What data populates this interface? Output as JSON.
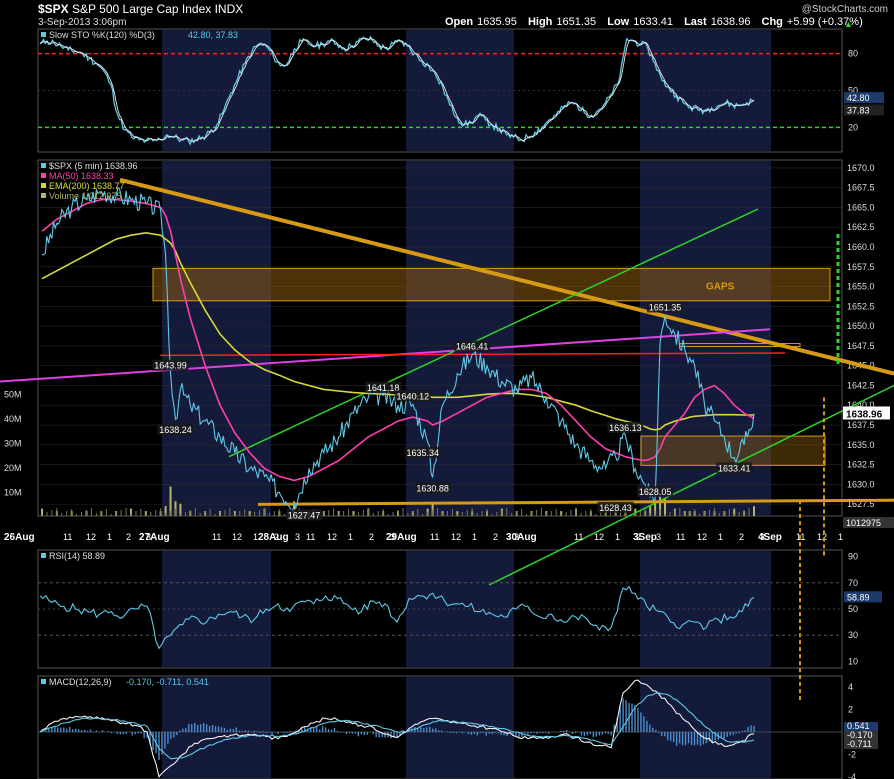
{
  "header": {
    "symbol": "$SPX",
    "name": "S&P 500 Large Cap Index",
    "exchange": "INDX",
    "date": "3-Sep-2013 3:06pm",
    "open_label": "Open",
    "open": "1635.95",
    "high_label": "High",
    "high": "1651.35",
    "low_label": "Low",
    "low": "1633.41",
    "last_label": "Last",
    "last": "1638.96",
    "chg_label": "Chg",
    "chg": "+5.99 (+0.37%)",
    "up_icon": "triangle-up-icon",
    "credit": "@StockCharts.com"
  },
  "colors": {
    "bg": "#000000",
    "band": "#141a3a",
    "price": "#5fc8e6",
    "ma50": "#ff3fb0",
    "ema200": "#d8d83a",
    "trend": "#d79a14",
    "green": "#2bd42b",
    "magenta": "#e040e0",
    "red": "#ff2020",
    "gap_fill": "#8a5a10",
    "volume": "#b6b36a",
    "grid": "#2a2a2a"
  },
  "chart_data": [
    {
      "type": "line",
      "panel": "sto",
      "legend": "Slow STO %K(120) %D(3)",
      "legend_values": "42.80, 37.83",
      "ylim": [
        0,
        100
      ],
      "yticks": [
        "80",
        "50",
        "20"
      ],
      "levels": [
        80,
        20
      ],
      "last_labels": [
        "42.80",
        "37.83"
      ],
      "series": [
        {
          "values": [
            88,
            90,
            89,
            86,
            83,
            82,
            80,
            76,
            72,
            66,
            55,
            30,
            18,
            12,
            10,
            9,
            9,
            10,
            14,
            12,
            10,
            9,
            10,
            12,
            16,
            22,
            34,
            48,
            60,
            72,
            82,
            88,
            86,
            78,
            70,
            72,
            84,
            90,
            88,
            86,
            88,
            90,
            88,
            84,
            86,
            90,
            92,
            91,
            86,
            84,
            88,
            90,
            86,
            80,
            74,
            70,
            62,
            52,
            38,
            28,
            22,
            24,
            30,
            26,
            22,
            18,
            14,
            12,
            10,
            12,
            16,
            20,
            26,
            30,
            36,
            40,
            38,
            32,
            30,
            34,
            40,
            48,
            60,
            92,
            90,
            88,
            84,
            72,
            58,
            52,
            46,
            40,
            36,
            35,
            34,
            36,
            38,
            40,
            38,
            38,
            40,
            42
          ]
        }
      ]
    },
    {
      "type": "line",
      "panel": "price",
      "legends": [
        "$SPX (5 min) 1638.96",
        "MA(50) 1638.33",
        "EMA(200) 1638.77",
        "Volume 1,012,975"
      ],
      "ylim": [
        1626,
        1671
      ],
      "yticks": [
        "1670.0",
        "1667.5",
        "1665.0",
        "1662.5",
        "1660.0",
        "1657.5",
        "1655.0",
        "1652.5",
        "1650.0",
        "1647.5",
        "1645.0",
        "1642.5",
        "1640.0",
        "1637.5",
        "1635.0",
        "1632.5",
        "1630.0",
        "1627.5"
      ],
      "volume_ticks": [
        "50M",
        "40M",
        "30M",
        "20M",
        "10M"
      ],
      "current_price_label": "1638.96",
      "volume_label": "1012975",
      "gap_label": "GAPS",
      "x_labels": [
        "26Aug",
        "11",
        "12",
        "1",
        "2",
        "3",
        "27Aug",
        "11",
        "12",
        "1",
        "2",
        "3",
        "28Aug",
        "11",
        "12",
        "1",
        "2",
        "3",
        "29Aug",
        "11",
        "12",
        "1",
        "2",
        "3",
        "30Aug",
        "11",
        "12",
        "1",
        "2",
        "3",
        "3Sep",
        "11",
        "12",
        "1",
        "2",
        "3",
        "4Sep",
        "11",
        "12",
        "1"
      ],
      "price_labels": [
        {
          "text": "1643.99",
          "x": 26,
          "y": 1643.99
        },
        {
          "text": "1638.24",
          "x": 27,
          "y": 1638.24
        },
        {
          "text": "1627.47",
          "x": 53,
          "y": 1627.47
        },
        {
          "text": "1641.18",
          "x": 69,
          "y": 1641.18
        },
        {
          "text": "1640.12",
          "x": 75,
          "y": 1640.12
        },
        {
          "text": "1635.34",
          "x": 77,
          "y": 1635.34
        },
        {
          "text": "1630.88",
          "x": 79,
          "y": 1630.88
        },
        {
          "text": "1646.41",
          "x": 87,
          "y": 1646.41
        },
        {
          "text": "1636.13",
          "x": 118,
          "y": 1636.13
        },
        {
          "text": "1628.43",
          "x": 116,
          "y": 1628.43
        },
        {
          "text": "1628.05",
          "x": 124,
          "y": 1628.05
        },
        {
          "text": "1651.35",
          "x": 126,
          "y": 1651.35
        },
        {
          "text": "1633.41",
          "x": 140,
          "y": 1633.41
        }
      ],
      "x": [
        0,
        3,
        6,
        9,
        12,
        15,
        18,
        21,
        24,
        25,
        26,
        27,
        28,
        30,
        33,
        36,
        39,
        42,
        45,
        48,
        51,
        54,
        57,
        60,
        63,
        66,
        69,
        72,
        75,
        78,
        79,
        81,
        84,
        87,
        90,
        93,
        96,
        99,
        102,
        105,
        108,
        111,
        114,
        116,
        118,
        120,
        122,
        123,
        124,
        125,
        126,
        128,
        130,
        131,
        132,
        134,
        136,
        138,
        140,
        142,
        144
      ],
      "series": [
        {
          "name": "$SPX",
          "values": [
            1659,
            1663,
            1665,
            1666,
            1667,
            1666.5,
            1666,
            1665.5,
            1664.5,
            1659,
            1643.99,
            1638.24,
            1642,
            1640,
            1638,
            1636,
            1634,
            1632,
            1631,
            1629,
            1627.47,
            1632,
            1634,
            1636,
            1639,
            1641,
            1641.18,
            1640,
            1640.12,
            1635.34,
            1630.88,
            1640,
            1644,
            1646.41,
            1645,
            1643,
            1642,
            1643.5,
            1641,
            1638,
            1635,
            1633,
            1632,
            1633.5,
            1636.13,
            1632,
            1630,
            1628.43,
            1628.05,
            1648,
            1651.35,
            1649,
            1647,
            1646,
            1645,
            1640,
            1638,
            1636,
            1633.41,
            1635,
            1638.96
          ]
        },
        {
          "name": "MA(50)",
          "values": [
            1662,
            1663.5,
            1664.5,
            1665.5,
            1666,
            1666,
            1665.8,
            1665.5,
            1665,
            1664,
            1662,
            1659,
            1656,
            1651,
            1645,
            1640,
            1636.5,
            1634,
            1632,
            1631,
            1630.5,
            1631,
            1632,
            1633,
            1634.5,
            1636,
            1637,
            1638,
            1638.5,
            1638,
            1637.5,
            1638,
            1639,
            1640,
            1641,
            1641.5,
            1642,
            1642,
            1641.5,
            1640,
            1638,
            1636,
            1634.5,
            1634,
            1633.5,
            1633.2,
            1633,
            1633.2,
            1633.5,
            1634.5,
            1636,
            1637.5,
            1639,
            1640,
            1641,
            1642,
            1642.5,
            1641.5,
            1640,
            1639,
            1638.33
          ]
        },
        {
          "name": "EMA(200)",
          "values": [
            1656,
            1657,
            1658,
            1659,
            1660,
            1661,
            1661.5,
            1661.8,
            1661.5,
            1661,
            1660.5,
            1659.5,
            1658,
            1655.5,
            1652,
            1649,
            1647,
            1645.5,
            1644.5,
            1643.8,
            1643,
            1642.5,
            1642,
            1641.8,
            1641.6,
            1641.5,
            1641.4,
            1641.3,
            1641.2,
            1641.1,
            1641,
            1641,
            1641,
            1641.2,
            1641.4,
            1641.5,
            1641.5,
            1641.3,
            1641,
            1640.5,
            1640,
            1639.3,
            1638.7,
            1638.3,
            1638,
            1637.7,
            1637.3,
            1637,
            1636.9,
            1637,
            1637.5,
            1638,
            1638.3,
            1638.5,
            1638.6,
            1638.7,
            1638.8,
            1638.8,
            1638.8,
            1638.77,
            1638.77
          ]
        }
      ],
      "volume": [
        3,
        2,
        2,
        2,
        2,
        2,
        3,
        2,
        2,
        4,
        12,
        6,
        5,
        2,
        2,
        2,
        2,
        2,
        3,
        2,
        6,
        2,
        2,
        2,
        2,
        3,
        2,
        2,
        2,
        3,
        5,
        2,
        2,
        2,
        2,
        3,
        2,
        2,
        2,
        2,
        3,
        2,
        2,
        3,
        2,
        3,
        2,
        4,
        6,
        8,
        7,
        3,
        2,
        2,
        2,
        2,
        2,
        2,
        3,
        2,
        4
      ],
      "volume_ylim": [
        0,
        55
      ]
    },
    {
      "type": "line",
      "panel": "rsi",
      "legend": "RSI(14) 58.89",
      "ylim": [
        5,
        95
      ],
      "yticks": [
        "90",
        "70",
        "50",
        "30",
        "10"
      ],
      "levels": [
        70,
        30
      ],
      "last_label": "58.89",
      "series": [
        {
          "values": [
            60,
            55,
            52,
            50,
            48,
            46,
            48,
            44,
            50,
            52,
            20,
            30,
            38,
            44,
            40,
            46,
            48,
            44,
            42,
            50,
            54,
            48,
            56,
            54,
            60,
            58,
            52,
            48,
            56,
            54,
            40,
            58,
            60,
            62,
            56,
            54,
            52,
            48,
            46,
            44,
            50,
            52,
            44,
            46,
            40,
            44,
            42,
            34,
            36,
            66,
            62,
            52,
            48,
            40,
            38,
            40,
            36,
            42,
            44,
            48,
            58.89
          ]
        }
      ]
    },
    {
      "type": "line",
      "panel": "macd",
      "legend": "MACD(12,26,9)",
      "legend_values": "-0.170, -0.711, 0.541",
      "ylim": [
        -4.2,
        5
      ],
      "yticks": [
        "4",
        "2",
        "0",
        "-2",
        "-4"
      ],
      "last_labels": [
        "0.541",
        "-0.170",
        "-0.711"
      ],
      "series": [
        {
          "name": "MACD",
          "values": [
            0,
            0.8,
            1.2,
            1.4,
            1.3,
            1.2,
            1,
            0.8,
            0.6,
            0,
            -4,
            -3,
            -2,
            -1,
            -0.6,
            -0.4,
            -0.3,
            -0.3,
            -0.2,
            -0.4,
            -0.6,
            -0.2,
            0.4,
            0.8,
            1.2,
            1.1,
            0.9,
            0.6,
            0.4,
            -0.2,
            -0.5,
            0.3,
            0.9,
            1.2,
            1,
            0.8,
            0.6,
            0.5,
            0.3,
            0,
            -0.4,
            -0.6,
            -0.5,
            -0.4,
            -0.2,
            -0.5,
            -0.9,
            -1.2,
            -1.4,
            3.5,
            4.6,
            4.2,
            3.4,
            2.4,
            1.2,
            0.2,
            -0.6,
            -1.1,
            -1.2,
            -0.8,
            -0.17
          ]
        },
        {
          "name": "Signal",
          "values": [
            0,
            0.4,
            0.8,
            1.1,
            1.2,
            1.2,
            1.1,
            1,
            0.8,
            0.5,
            -1.5,
            -2.4,
            -2.3,
            -1.8,
            -1.3,
            -0.9,
            -0.6,
            -0.4,
            -0.3,
            -0.3,
            -0.4,
            -0.3,
            0,
            0.4,
            0.8,
            1,
            1,
            0.8,
            0.6,
            0.3,
            0,
            0.1,
            0.5,
            0.9,
            1,
            0.9,
            0.8,
            0.6,
            0.5,
            0.3,
            0,
            -0.3,
            -0.4,
            -0.4,
            -0.3,
            -0.4,
            -0.6,
            -0.9,
            -1.1,
            0.5,
            2.2,
            3.2,
            3.5,
            3.2,
            2.4,
            1.4,
            0.4,
            -0.4,
            -0.9,
            -0.9,
            -0.711
          ]
        }
      ]
    }
  ]
}
